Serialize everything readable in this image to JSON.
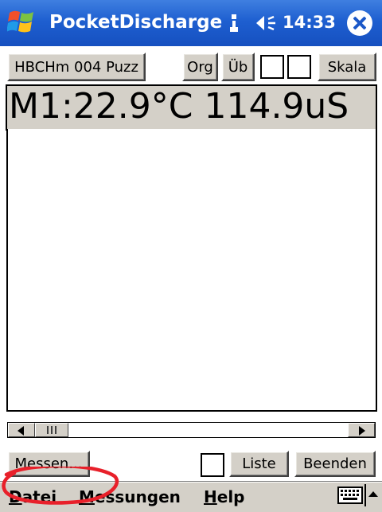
{
  "titlebar": {
    "app_title": "PocketDischarge",
    "clock": "14:33",
    "icons": {
      "start": "windows-flag-icon",
      "connectivity": "connectivity-icon",
      "volume": "speaker-volume-icon",
      "close": "close-icon"
    },
    "colors": {
      "bar": "#1e5fd0",
      "text": "#ffffff"
    }
  },
  "toolbar": {
    "device_label": "HBCHm 004 Puzz",
    "org_label": "Org",
    "ub_label": "Üb",
    "skala_label": "Skala"
  },
  "reading": {
    "text": "M1:22.9°C 114.9uS"
  },
  "bottom_actions": {
    "messen_label": "Messen...",
    "liste_label": "Liste",
    "beenden_label": "Beenden"
  },
  "menu": {
    "items": [
      {
        "first": "D",
        "rest": "atei"
      },
      {
        "first": "M",
        "rest": "essungen"
      },
      {
        "first": "H",
        "rest": "elp"
      }
    ],
    "icons": {
      "keyboard": "keyboard-icon",
      "sip_toggle": "up-arrow-icon"
    }
  },
  "annotation": {
    "color": "#e8202a"
  },
  "colors": {
    "button_face": "#d4d0c8",
    "window_bg": "#ffffff"
  }
}
